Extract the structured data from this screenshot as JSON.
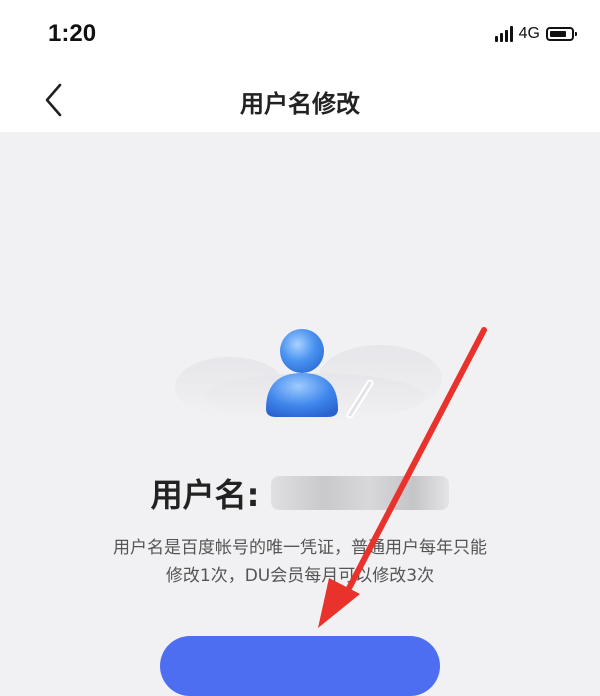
{
  "status_bar": {
    "time": "1:20",
    "network": "4G",
    "icons": [
      "signal-icon",
      "battery-icon"
    ]
  },
  "nav": {
    "back_icon": "chevron-left-icon",
    "title": "用户名修改"
  },
  "profile": {
    "illustration_icon": "user-avatar-edit-icon",
    "username_label": "用户名:",
    "username_value": ""
  },
  "description": {
    "line1": "用户名是百度帐号的唯一凭证，普通用户每年只能",
    "line2": "修改1次，DU会员每月可以修改3次"
  },
  "primary_button": {
    "label": ""
  },
  "annotation": {
    "type": "red-arrow",
    "color": "#e8322b"
  },
  "colors": {
    "accent": "#4e6ef2",
    "background": "#f1f1f3",
    "header_bg": "#ffffff"
  }
}
